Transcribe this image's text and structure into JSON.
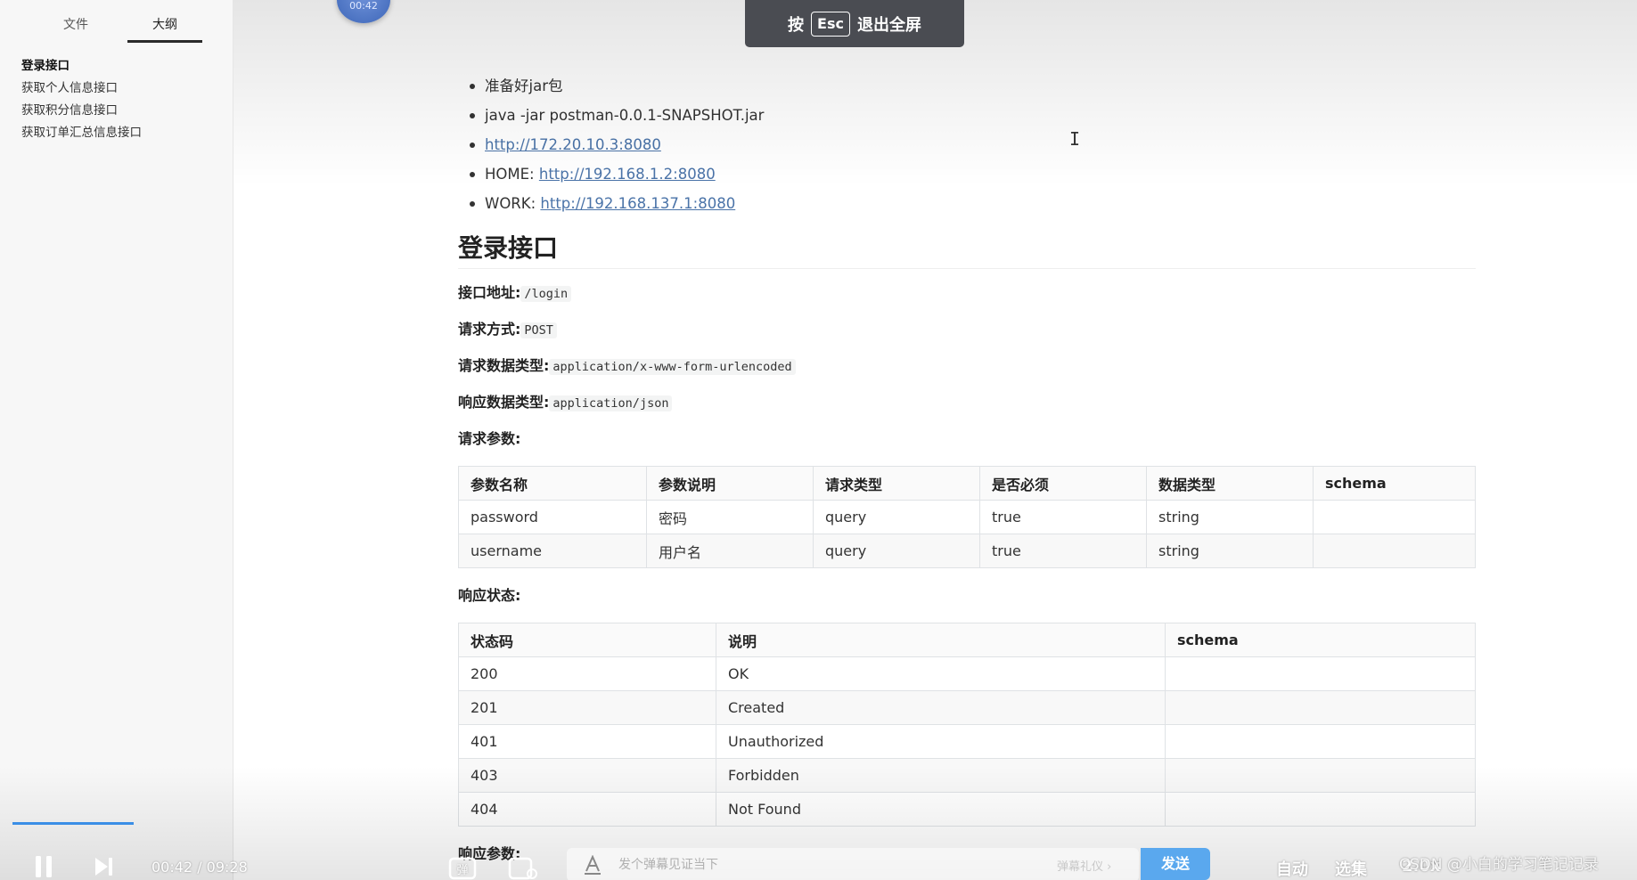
{
  "sidebar": {
    "tabs": [
      {
        "label": "文件"
      },
      {
        "label": "大纲"
      }
    ],
    "outline": [
      {
        "label": "登录接口"
      },
      {
        "label": "获取个人信息接口"
      },
      {
        "label": "获取积分信息接口"
      },
      {
        "label": "获取订单汇总信息接口"
      }
    ]
  },
  "overlay": {
    "esc_prefix": "按",
    "esc_key": "Esc",
    "esc_suffix": "退出全屏",
    "bubble_text": "00:42"
  },
  "bullets": {
    "b1": "准备好jar包",
    "b2": "java -jar postman-0.0.1-SNAPSHOT.jar",
    "b3_link": "http://172.20.10.3:8080",
    "b4_prefix": "HOME: ",
    "b4_link": "http://192.168.1.2:8080",
    "b5_prefix": "WORK: ",
    "b5_link": "http://192.168.137.1:8080"
  },
  "section": {
    "title": "登录接口",
    "address_label": "接口地址:",
    "address_value": "/login",
    "method_label": "请求方式:",
    "method_value": "POST",
    "req_type_label": "请求数据类型:",
    "req_type_value": "application/x-www-form-urlencoded",
    "resp_type_label": "响应数据类型:",
    "resp_type_value": "application/json",
    "params_label": "请求参数:",
    "status_label": "响应状态:",
    "resp_params_label": "响应参数:"
  },
  "params_table": {
    "headers": [
      "参数名称",
      "参数说明",
      "请求类型",
      "是否必须",
      "数据类型",
      "schema"
    ],
    "rows": [
      [
        "password",
        "密码",
        "query",
        "true",
        "string",
        ""
      ],
      [
        "username",
        "用户名",
        "query",
        "true",
        "string",
        ""
      ]
    ]
  },
  "status_table": {
    "headers": [
      "状态码",
      "说明",
      "schema"
    ],
    "rows": [
      [
        "200",
        "OK",
        ""
      ],
      [
        "201",
        "Created",
        ""
      ],
      [
        "401",
        "Unauthorized",
        ""
      ],
      [
        "403",
        "Forbidden",
        ""
      ],
      [
        "404",
        "Not Found",
        ""
      ]
    ]
  },
  "player": {
    "time_current": "00:42",
    "time_total": "09:28",
    "time_sep": " / ",
    "danmaku_icon": "弹",
    "danmaku_placeholder": "发个弹幕见证当下",
    "etiquette": "弹幕礼仪 ›",
    "send": "发送",
    "auto": "自动",
    "episodes": "选集",
    "speed": "2.0x",
    "progress_fraction": 0.075
  },
  "watermark": "CSDN @小白的学习笔记记录"
}
